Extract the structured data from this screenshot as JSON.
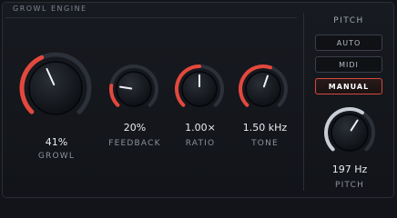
{
  "panel": {
    "title": "GROWL ENGINE"
  },
  "colors": {
    "accent": "#e4483d",
    "accent_dark": "#7a2420",
    "pitch_arc": "#c9ced6",
    "track": "#2c3038"
  },
  "knobs": [
    {
      "id": "growl",
      "value_text": "41%",
      "label": "GROWL",
      "level": 0.41
    },
    {
      "id": "feedback",
      "value_text": "20%",
      "label": "FEEDBACK",
      "level": 0.2
    },
    {
      "id": "ratio",
      "value_text": "1.00×",
      "label": "RATIO",
      "level": 0.5
    },
    {
      "id": "tone",
      "value_text": "1.50 kHz",
      "label": "TONE",
      "level": 0.57
    }
  ],
  "pitch": {
    "section_title": "PITCH",
    "modes": [
      "AUTO",
      "MIDI",
      "MANUAL"
    ],
    "selected_mode": "MANUAL",
    "knob": {
      "value_text": "197 Hz",
      "label": "PITCH",
      "level": 0.62
    }
  }
}
